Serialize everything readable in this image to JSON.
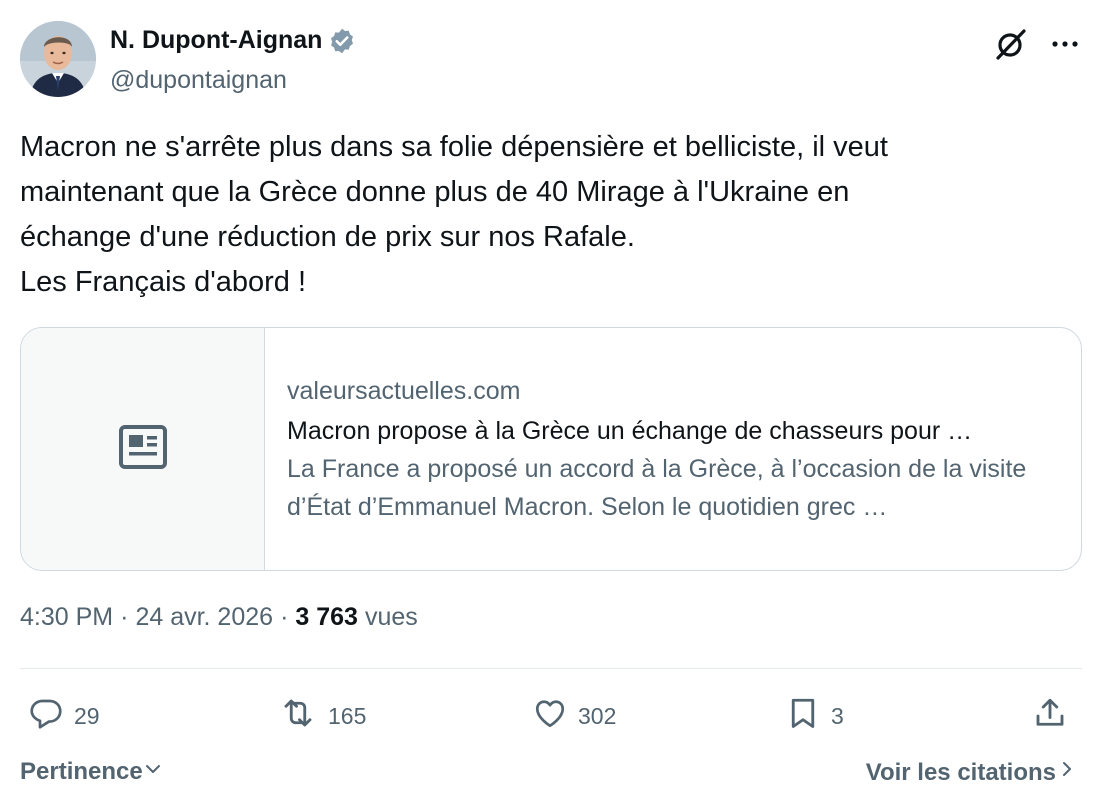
{
  "author": {
    "display_name": "N. Dupont-Aignan",
    "handle": "@dupontaignan",
    "verified": true,
    "verified_color": "#829aab"
  },
  "tweet": {
    "text": "Macron ne s'arrête plus dans sa folie dépensière et belliciste, il veut\nmaintenant que la Grèce donne plus de 40 Mirage à l'Ukraine en\néchange d'une réduction de prix sur nos Rafale.\nLes Français d'abord !"
  },
  "link_card": {
    "domain": "valeursactuelles.com",
    "title": "Macron propose à la Grèce un échange de chasseurs pour …",
    "description": "La France a proposé un accord à la Grèce, à l’occasion de la visite d’État d’Emmanuel Macron. Selon le quotidien grec …",
    "thumbnail_icon": "newspaper-icon"
  },
  "meta": {
    "time": "4:30 PM",
    "separator": "·",
    "date": "24 avr. 2026",
    "views_count": "3 763",
    "views_label": "vues"
  },
  "actions": {
    "replies": "29",
    "reposts": "165",
    "likes": "302",
    "bookmarks": "3"
  },
  "footer": {
    "sort_label": "Pertinence",
    "quotes_label": "Voir les citations"
  },
  "colors": {
    "text_primary": "#0f1419",
    "text_secondary": "#536471",
    "border": "#cfd9de"
  }
}
